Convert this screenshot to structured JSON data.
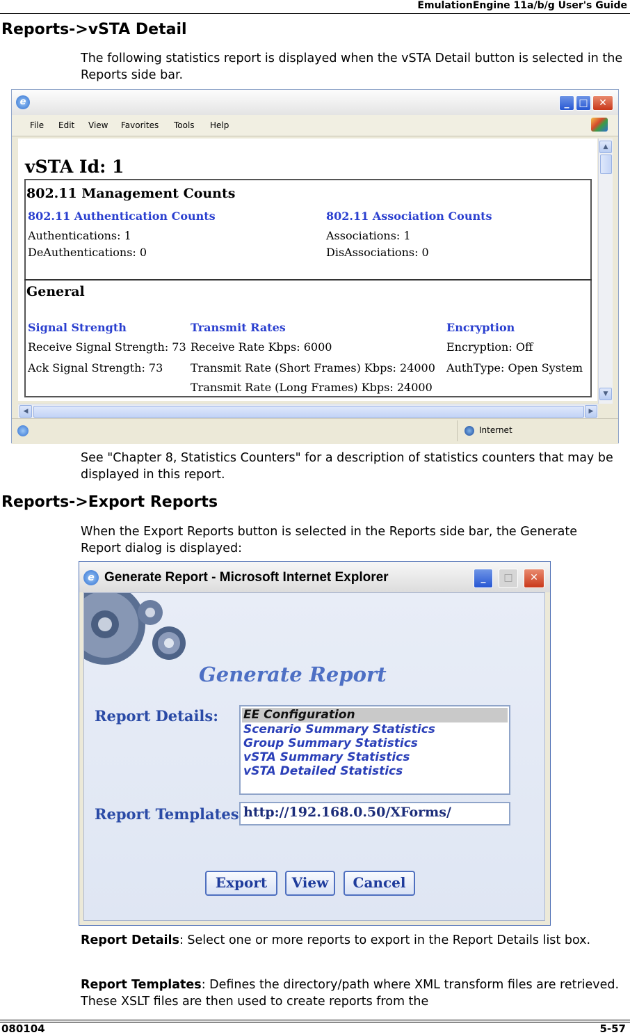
{
  "header": {
    "guide_title": "EmulationEngine 11a/b/g User's Guide"
  },
  "section1": {
    "heading": "Reports->vSTA Detail",
    "intro": "The following statistics report is displayed when the vSTA Detail button is selected in the Reports side bar.",
    "after": "See \"Chapter 8, Statistics Counters\" for a description of statistics counters that may be displayed in this report."
  },
  "browser": {
    "menu": [
      "File",
      "Edit",
      "View",
      "Favorites",
      "Tools",
      "Help"
    ],
    "status_zone": "Internet",
    "report": {
      "title": "vSTA Id: 1",
      "mgmt_heading": "802.11 Management Counts",
      "auth_heading": "802.11 Authentication Counts",
      "auth_lines": [
        "Authentications: 1",
        "DeAuthentications: 0"
      ],
      "assoc_heading": "802.11 Association Counts",
      "assoc_lines": [
        "Associations: 1",
        "DisAssociations: 0"
      ],
      "general_heading": "General",
      "signal_heading": "Signal Strength",
      "signal_lines": [
        "Receive Signal Strength: 73",
        "Ack Signal Strength: 73"
      ],
      "rates_heading": "Transmit Rates",
      "rates_lines": [
        "Receive Rate Kbps: 6000",
        "Transmit Rate (Short Frames) Kbps: 24000",
        "Transmit Rate (Long Frames) Kbps: 24000"
      ],
      "enc_heading": "Encryption",
      "enc_lines": [
        "Encryption: Off",
        "AuthType: Open System"
      ]
    }
  },
  "section2": {
    "heading": "Reports->Export Reports",
    "intro": "When the Export Reports button is selected in the Reports side bar, the Generate Report dialog is displayed:"
  },
  "dialog": {
    "window_title": "Generate Report - Microsoft Internet Explorer",
    "banner": "Generate Report",
    "details_label": "Report Details:",
    "details_items": [
      "EE Configuration",
      "Scenario Summary Statistics",
      "Group Summary Statistics",
      "vSTA Summary Statistics",
      "vSTA Detailed Statistics"
    ],
    "templates_label": "Report Templates",
    "templates_value": "http://192.168.0.50/XForms/",
    "buttons": {
      "export": "Export",
      "view": "View",
      "cancel": "Cancel"
    }
  },
  "descriptions": {
    "details_term": "Report Details",
    "details_text": ": Select one or more reports to export in the Report Details list box.",
    "templates_term": "Report Templates",
    "templates_text": ": Defines the directory/path where XML transform files are retrieved. These XSLT files are then used to create reports from the"
  },
  "footer": {
    "doc_id": "080104",
    "page": "5-57"
  }
}
